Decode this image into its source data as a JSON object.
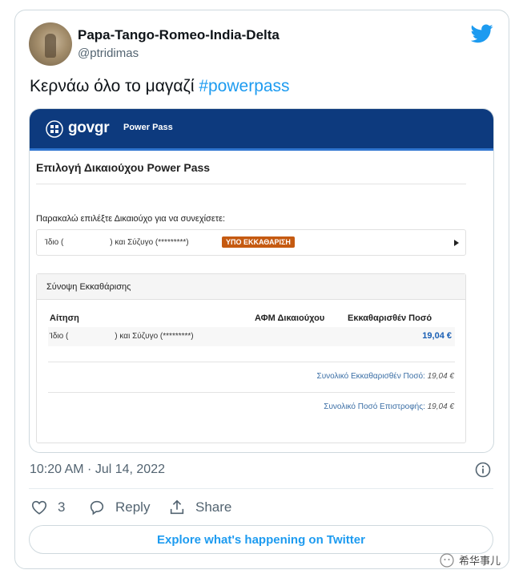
{
  "tweet": {
    "display_name": "Papa-Tango-Romeo-India-Delta",
    "handle": "@ptridimas",
    "text": "Κερνάω όλο το μαγαζί ",
    "hashtag": "#powerpass",
    "timestamp": "10:20 AM · Jul 14, 2022"
  },
  "embedded": {
    "logo_gov": "gov",
    "logo_gr": "gr",
    "header_title": "Power Pass",
    "form_title": "Επιλογή Δικαιούχου Power Pass",
    "prompt": "Παρακαλώ επιλέξτε Δικαιούχο για να συνεχίσετε:",
    "selection": {
      "part1": "Ίδιο (",
      "part2": ") και Σύζυγο (*********)",
      "badge": "ΥΠΟ ΕΚΚΑΘΑΡΙΣΗ"
    },
    "summary": {
      "title": "Σύνοψη Εκκαθάρισης",
      "columns": [
        "Αίτηση",
        "ΑΦΜ Δικαιούχου",
        "Εκκαθαρισθέν Ποσό"
      ],
      "row": {
        "part1": "Ίδιο (",
        "part2": ") και Σύζυγο (*********)",
        "amount": "19,04 €"
      },
      "total_cleared_label": "Συνολικό Εκκαθαρισθέν Ποσό:",
      "total_cleared_value": "19,04 €",
      "total_refund_label": "Συνολικό Ποσό Επιστροφής:",
      "total_refund_value": "19,04 €"
    }
  },
  "actions": {
    "like_count": "3",
    "reply_label": "Reply",
    "share_label": "Share"
  },
  "explore_label": "Explore what's happening on Twitter",
  "watermark": "希华事儿",
  "colors": {
    "twitter_blue": "#1d9bf0",
    "gov_blue": "#0d3a7e",
    "badge_orange": "#c55a11"
  }
}
